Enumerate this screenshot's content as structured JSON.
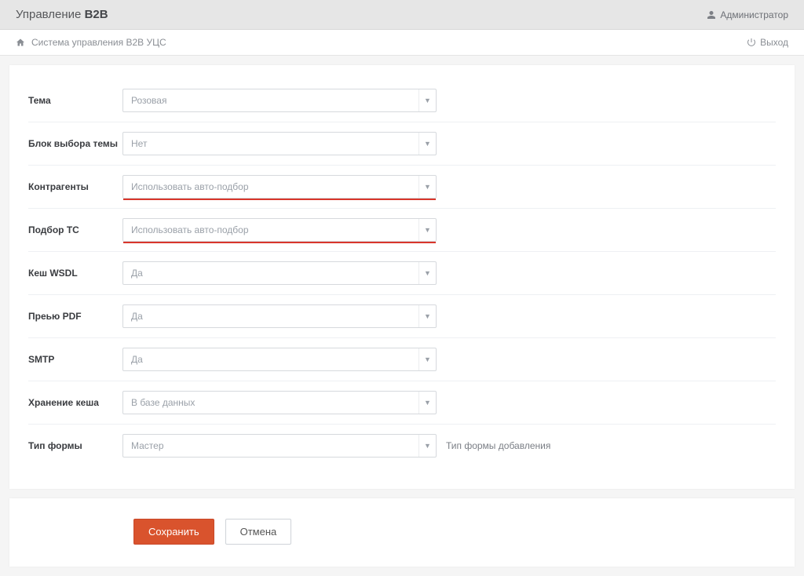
{
  "header": {
    "title_prefix": "Управление ",
    "title_bold": "B2B",
    "admin_label": "Администратор"
  },
  "breadcrumb": {
    "text": "Система управления B2B УЦС",
    "exit_label": "Выход"
  },
  "form": {
    "rows": [
      {
        "label": "Тема",
        "value": "Розовая",
        "highlight": false,
        "help": ""
      },
      {
        "label": "Блок выбора темы",
        "value": "Нет",
        "highlight": false,
        "help": ""
      },
      {
        "label": "Контрагенты",
        "value": "Использовать авто-подбор",
        "highlight": true,
        "help": ""
      },
      {
        "label": "Подбор ТС",
        "value": "Использовать авто-подбор",
        "highlight": true,
        "help": ""
      },
      {
        "label": "Кеш WSDL",
        "value": "Да",
        "highlight": false,
        "help": ""
      },
      {
        "label": "Преью PDF",
        "value": "Да",
        "highlight": false,
        "help": ""
      },
      {
        "label": "SMTP",
        "value": "Да",
        "highlight": false,
        "help": ""
      },
      {
        "label": "Хранение кеша",
        "value": "В базе данных",
        "highlight": false,
        "help": ""
      },
      {
        "label": "Тип формы",
        "value": "Мастер",
        "highlight": false,
        "help": "Тип формы добавления"
      }
    ]
  },
  "actions": {
    "save": "Сохранить",
    "cancel": "Отмена"
  }
}
